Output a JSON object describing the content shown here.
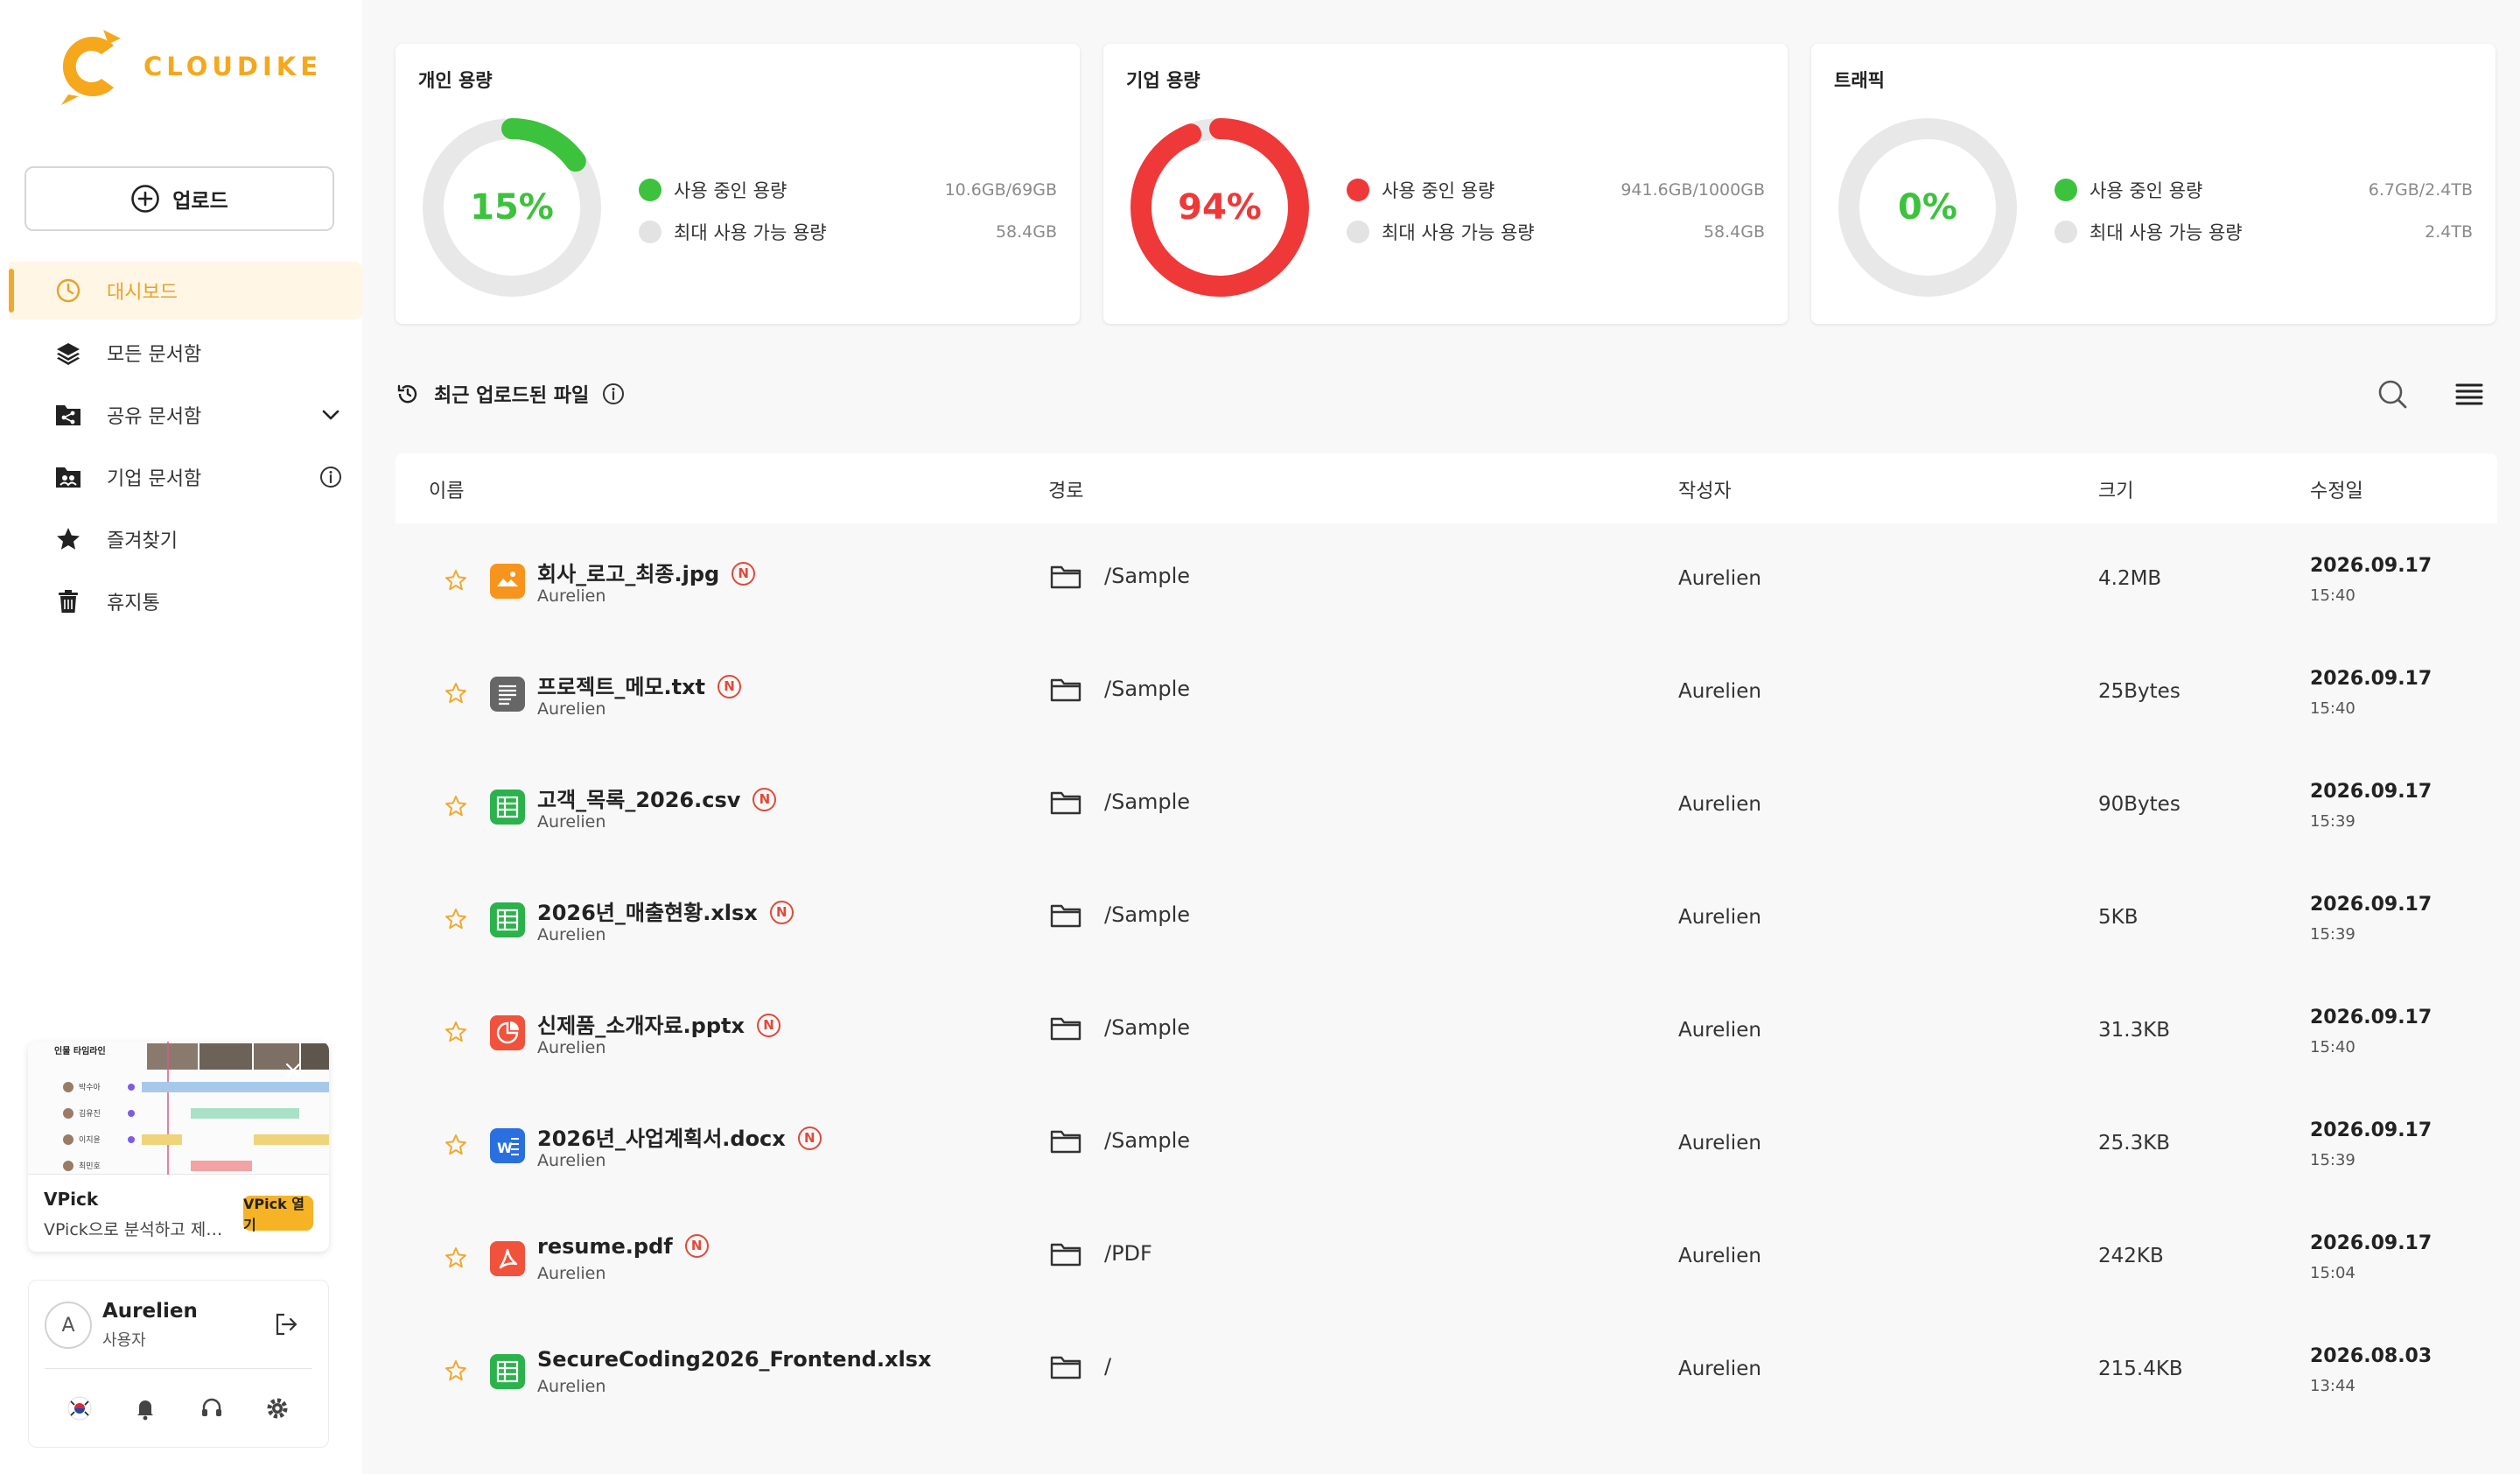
{
  "app": {
    "brand": "CLOUDIKE",
    "colors": {
      "accent": "#f0a92e",
      "green": "#3cc23c",
      "red": "#ef3838",
      "gray_ring": "#e5e5e5"
    }
  },
  "sidebar": {
    "upload_label": "업로드",
    "items": [
      {
        "label": "대시보드",
        "icon": "dashboard-icon",
        "active": true
      },
      {
        "label": "모든 문서함",
        "icon": "layers-icon"
      },
      {
        "label": "공유 문서함",
        "icon": "shared-folder-icon",
        "extra": "chevron-down-icon"
      },
      {
        "label": "기업 문서함",
        "icon": "company-folder-icon",
        "extra": "info-icon"
      },
      {
        "label": "즐겨찾기",
        "icon": "star-icon"
      },
      {
        "label": "휴지통",
        "icon": "trash-icon"
      }
    ],
    "promo": {
      "title": "VPick",
      "description": "VPick으로 분석하고 제…",
      "button": "VPick 열기",
      "thumb_heading": "인물 타임라인",
      "thumb_names": [
        "박수아",
        "김유진",
        "이지윤",
        "최민호"
      ]
    },
    "user": {
      "initial": "A",
      "name": "Aurelien",
      "role": "사용자"
    }
  },
  "storage": [
    {
      "title": "개인 용량",
      "percent": "15%",
      "used_fraction": 0.15,
      "color": "#3cc23c",
      "legend_used": "사용 중인 용량",
      "legend_used_value": "10.6GB/69GB",
      "legend_max": "최대 사용 가능 용량",
      "legend_max_value": "58.4GB"
    },
    {
      "title": "기업 용량",
      "percent": "94%",
      "used_fraction": 0.94,
      "color": "#ef3838",
      "legend_used": "사용 중인 용량",
      "legend_used_value": "941.6GB/1000GB",
      "legend_max": "최대 사용 가능 용량",
      "legend_max_value": "58.4GB"
    },
    {
      "title": "트래픽",
      "percent": "0%",
      "used_fraction": 0.0,
      "color": "#3cc23c",
      "legend_used": "사용 중인 용량",
      "legend_used_value": "6.7GB/2.4TB",
      "legend_max": "최대 사용 가능 용량",
      "legend_max_value": "2.4TB"
    }
  ],
  "recent": {
    "title": "최근 업로드된 파일",
    "columns": {
      "name": "이름",
      "path": "경로",
      "author": "작성자",
      "size": "크기",
      "modified": "수정일"
    },
    "badge": "N",
    "files": [
      {
        "name": "회사_로고_최종.jpg",
        "owner": "Aurelien",
        "icon": "image-file-icon",
        "icon_color": "#f7941d",
        "new": true,
        "path": "/Sample",
        "author": "Aurelien",
        "size": "4.2MB",
        "date": "2026.09.17",
        "time": "15:40"
      },
      {
        "name": "프로젝트_메모.txt",
        "owner": "Aurelien",
        "icon": "text-file-icon",
        "icon_color": "#666666",
        "new": true,
        "path": "/Sample",
        "author": "Aurelien",
        "size": "25Bytes",
        "date": "2026.09.17",
        "time": "15:40"
      },
      {
        "name": "고객_목록_2026.csv",
        "owner": "Aurelien",
        "icon": "spreadsheet-file-icon",
        "icon_color": "#2bb24c",
        "new": true,
        "path": "/Sample",
        "author": "Aurelien",
        "size": "90Bytes",
        "date": "2026.09.17",
        "time": "15:39"
      },
      {
        "name": "2026년_매출현황.xlsx",
        "owner": "Aurelien",
        "icon": "spreadsheet-file-icon",
        "icon_color": "#2bb24c",
        "new": true,
        "path": "/Sample",
        "author": "Aurelien",
        "size": "5KB",
        "date": "2026.09.17",
        "time": "15:39"
      },
      {
        "name": "신제품_소개자료.pptx",
        "owner": "Aurelien",
        "icon": "presentation-file-icon",
        "icon_color": "#f0523b",
        "new": true,
        "path": "/Sample",
        "author": "Aurelien",
        "size": "31.3KB",
        "date": "2026.09.17",
        "time": "15:40"
      },
      {
        "name": "2026년_사업계획서.docx",
        "owner": "Aurelien",
        "icon": "word-file-icon",
        "icon_color": "#2a6fe0",
        "new": true,
        "path": "/Sample",
        "author": "Aurelien",
        "size": "25.3KB",
        "date": "2026.09.17",
        "time": "15:39"
      },
      {
        "name": "resume.pdf",
        "owner": "Aurelien",
        "icon": "pdf-file-icon",
        "icon_color": "#f0523b",
        "new": true,
        "path": "/PDF",
        "author": "Aurelien",
        "size": "242KB",
        "date": "2026.09.17",
        "time": "15:04"
      },
      {
        "name": "SecureCoding2026_Frontend.xlsx",
        "owner": "Aurelien",
        "icon": "spreadsheet-file-icon",
        "icon_color": "#2bb24c",
        "new": false,
        "path": "/",
        "author": "Aurelien",
        "size": "215.4KB",
        "date": "2026.08.03",
        "time": "13:44"
      }
    ]
  }
}
